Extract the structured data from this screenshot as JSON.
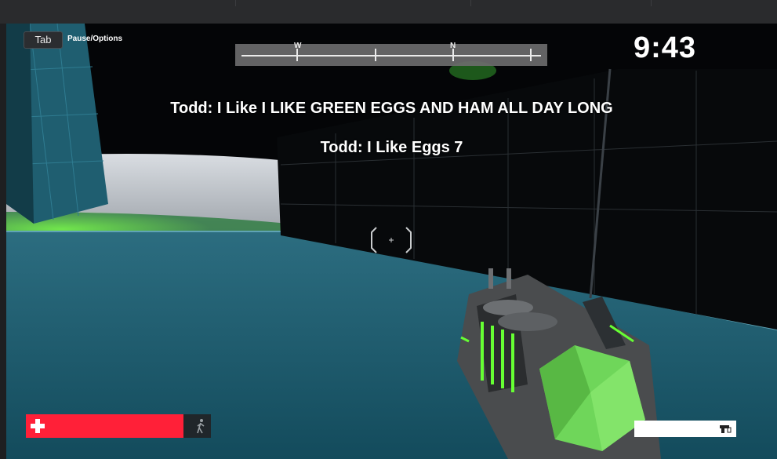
{
  "hud": {
    "tab_key": "Tab",
    "pause_label": "Pause/Options",
    "compass": {
      "west": "W",
      "north": "N"
    },
    "timer": "9:43",
    "health_fraction": 0.85
  },
  "chat": [
    "Todd: I Like I LIKE GREEN EGGS AND HAM ALL DAY LONG",
    "Todd: I Like Eggs 7"
  ],
  "icons": {
    "health": "plus-icon",
    "stance": "runner-icon",
    "ammo": "gun-icon",
    "crosshair": "crosshair-icon"
  },
  "colors": {
    "health": "#ff2038",
    "weapon_glow": "#66ff33",
    "floor": "#1e5c70"
  }
}
